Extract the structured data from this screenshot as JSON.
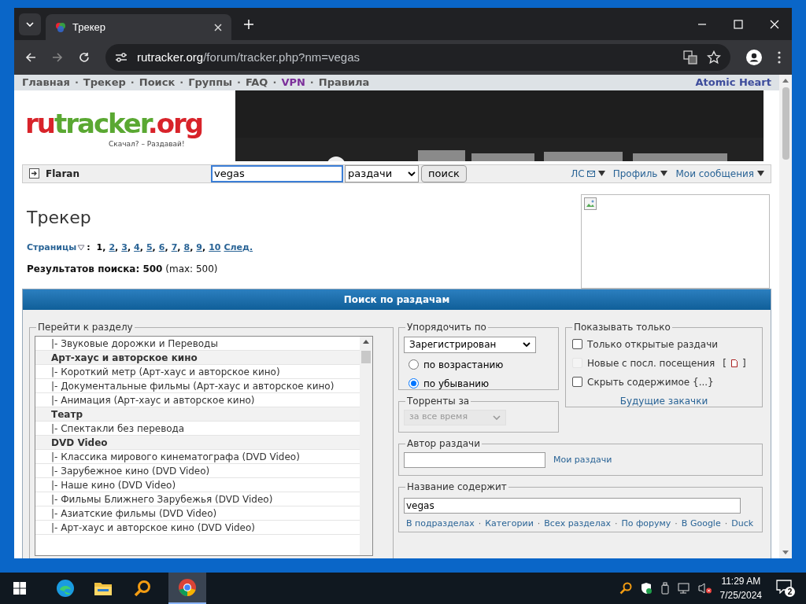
{
  "browser": {
    "tab_title": "Трекер",
    "url_host": "rutracker.org",
    "url_path": "/forum/tracker.php?nm=vegas"
  },
  "nav": {
    "links": [
      {
        "label": "Главная",
        "kind": "link"
      },
      {
        "label": "Трекер",
        "kind": "link"
      },
      {
        "label": "Поиск",
        "kind": "link"
      },
      {
        "label": "Группы",
        "kind": "link"
      },
      {
        "label": "FAQ",
        "kind": "link"
      },
      {
        "label": "VPN",
        "kind": "vpn"
      },
      {
        "label": "Правила",
        "kind": "link"
      }
    ],
    "separator": "·",
    "right_link": "Atomic Heart"
  },
  "logo": {
    "parts": [
      {
        "text": "ru",
        "color": "#d8232a"
      },
      {
        "text": "tracker",
        "color": "#5aa832"
      },
      {
        "text": ".org",
        "color": "#d8232a"
      }
    ],
    "tagline": "Скачал? – Раздавай!"
  },
  "userbar": {
    "username": "Flaran",
    "search_value": "vegas",
    "search_scope": "раздачи",
    "search_button": "поиск",
    "links": [
      {
        "label": "ЛС",
        "mail_icon": true
      },
      {
        "label": "Профиль"
      },
      {
        "label": "Мои сообщения"
      }
    ]
  },
  "page_title": "Трекер",
  "pagination": {
    "label": "Страницы",
    "separator": ":",
    "page_separator": ",",
    "pages": [
      {
        "label": "1",
        "selected": true
      },
      {
        "label": "2",
        "selected": false
      },
      {
        "label": "3",
        "selected": false
      },
      {
        "label": "4",
        "selected": false
      },
      {
        "label": "5",
        "selected": false
      },
      {
        "label": "6",
        "selected": false
      },
      {
        "label": "7",
        "selected": false
      },
      {
        "label": "8",
        "selected": false
      },
      {
        "label": "9",
        "selected": false
      },
      {
        "label": "10",
        "selected": false
      }
    ],
    "next": "След."
  },
  "results": "**Результатов поиска: 500** (max: 500)",
  "panel_title": "Поиск по раздачам",
  "forums": {
    "legend": "Перейти к разделу",
    "items": [
      {
        "label": "|- Звуковые дорожки и Переводы",
        "kind": "forum"
      },
      {
        "label": "Арт-хаус и авторское кино",
        "kind": "category"
      },
      {
        "label": "|- Короткий метр (Арт-хаус и авторское кино)",
        "kind": "forum"
      },
      {
        "label": "|- Документальные фильмы (Арт-хаус и авторское кино)",
        "kind": "forum"
      },
      {
        "label": "|- Анимация (Арт-хаус и авторское кино)",
        "kind": "forum"
      },
      {
        "label": "Театр",
        "kind": "category"
      },
      {
        "label": "|- Спектакли без перевода",
        "kind": "forum"
      },
      {
        "label": "DVD Video",
        "kind": "category"
      },
      {
        "label": "|- Классика мирового кинематографа (DVD Video)",
        "kind": "forum"
      },
      {
        "label": "|- Зарубежное кино (DVD Video)",
        "kind": "forum"
      },
      {
        "label": "|- Наше кино (DVD Video)",
        "kind": "forum"
      },
      {
        "label": "|- Фильмы Ближнего Зарубежья (DVD Video)",
        "kind": "forum"
      },
      {
        "label": "|- Азиатские фильмы (DVD Video)",
        "kind": "forum"
      },
      {
        "label": "|- Арт-хаус и авторское кино (DVD Video)",
        "kind": "forum"
      }
    ]
  },
  "sort": {
    "legend": "Упорядочить по",
    "value": "Зарегистрирован",
    "radios": [
      {
        "label": "по возрастанию",
        "selected": false
      },
      {
        "label": "по убыванию",
        "selected": true
      }
    ]
  },
  "period": {
    "legend": "Торренты за",
    "value": "за все время",
    "disabled": true
  },
  "show_only": {
    "legend": "Показывать только",
    "checkboxes": [
      {
        "label": "Только открытые раздачи",
        "checked": false,
        "disabled": false
      },
      {
        "label": "Новые с посл. посещения",
        "checked": false,
        "disabled": true,
        "bracket_open": "[",
        "bracket_close": "]"
      },
      {
        "label": "Скрыть содержимое {...}",
        "checked": false,
        "disabled": false
      }
    ],
    "link": "Будущие закачки"
  },
  "author": {
    "legend": "Автор раздачи",
    "link": "Мои раздачи"
  },
  "title_contains": {
    "legend": "Название содержит",
    "value": "vegas",
    "links": [
      "В подразделах",
      "Категории",
      "Всех разделах",
      "По форуму",
      "В Google",
      "Duck"
    ],
    "separator": "·"
  },
  "taskbar": {
    "time": "11:29 AM",
    "date": "7/25/2024",
    "notifications": "2"
  }
}
